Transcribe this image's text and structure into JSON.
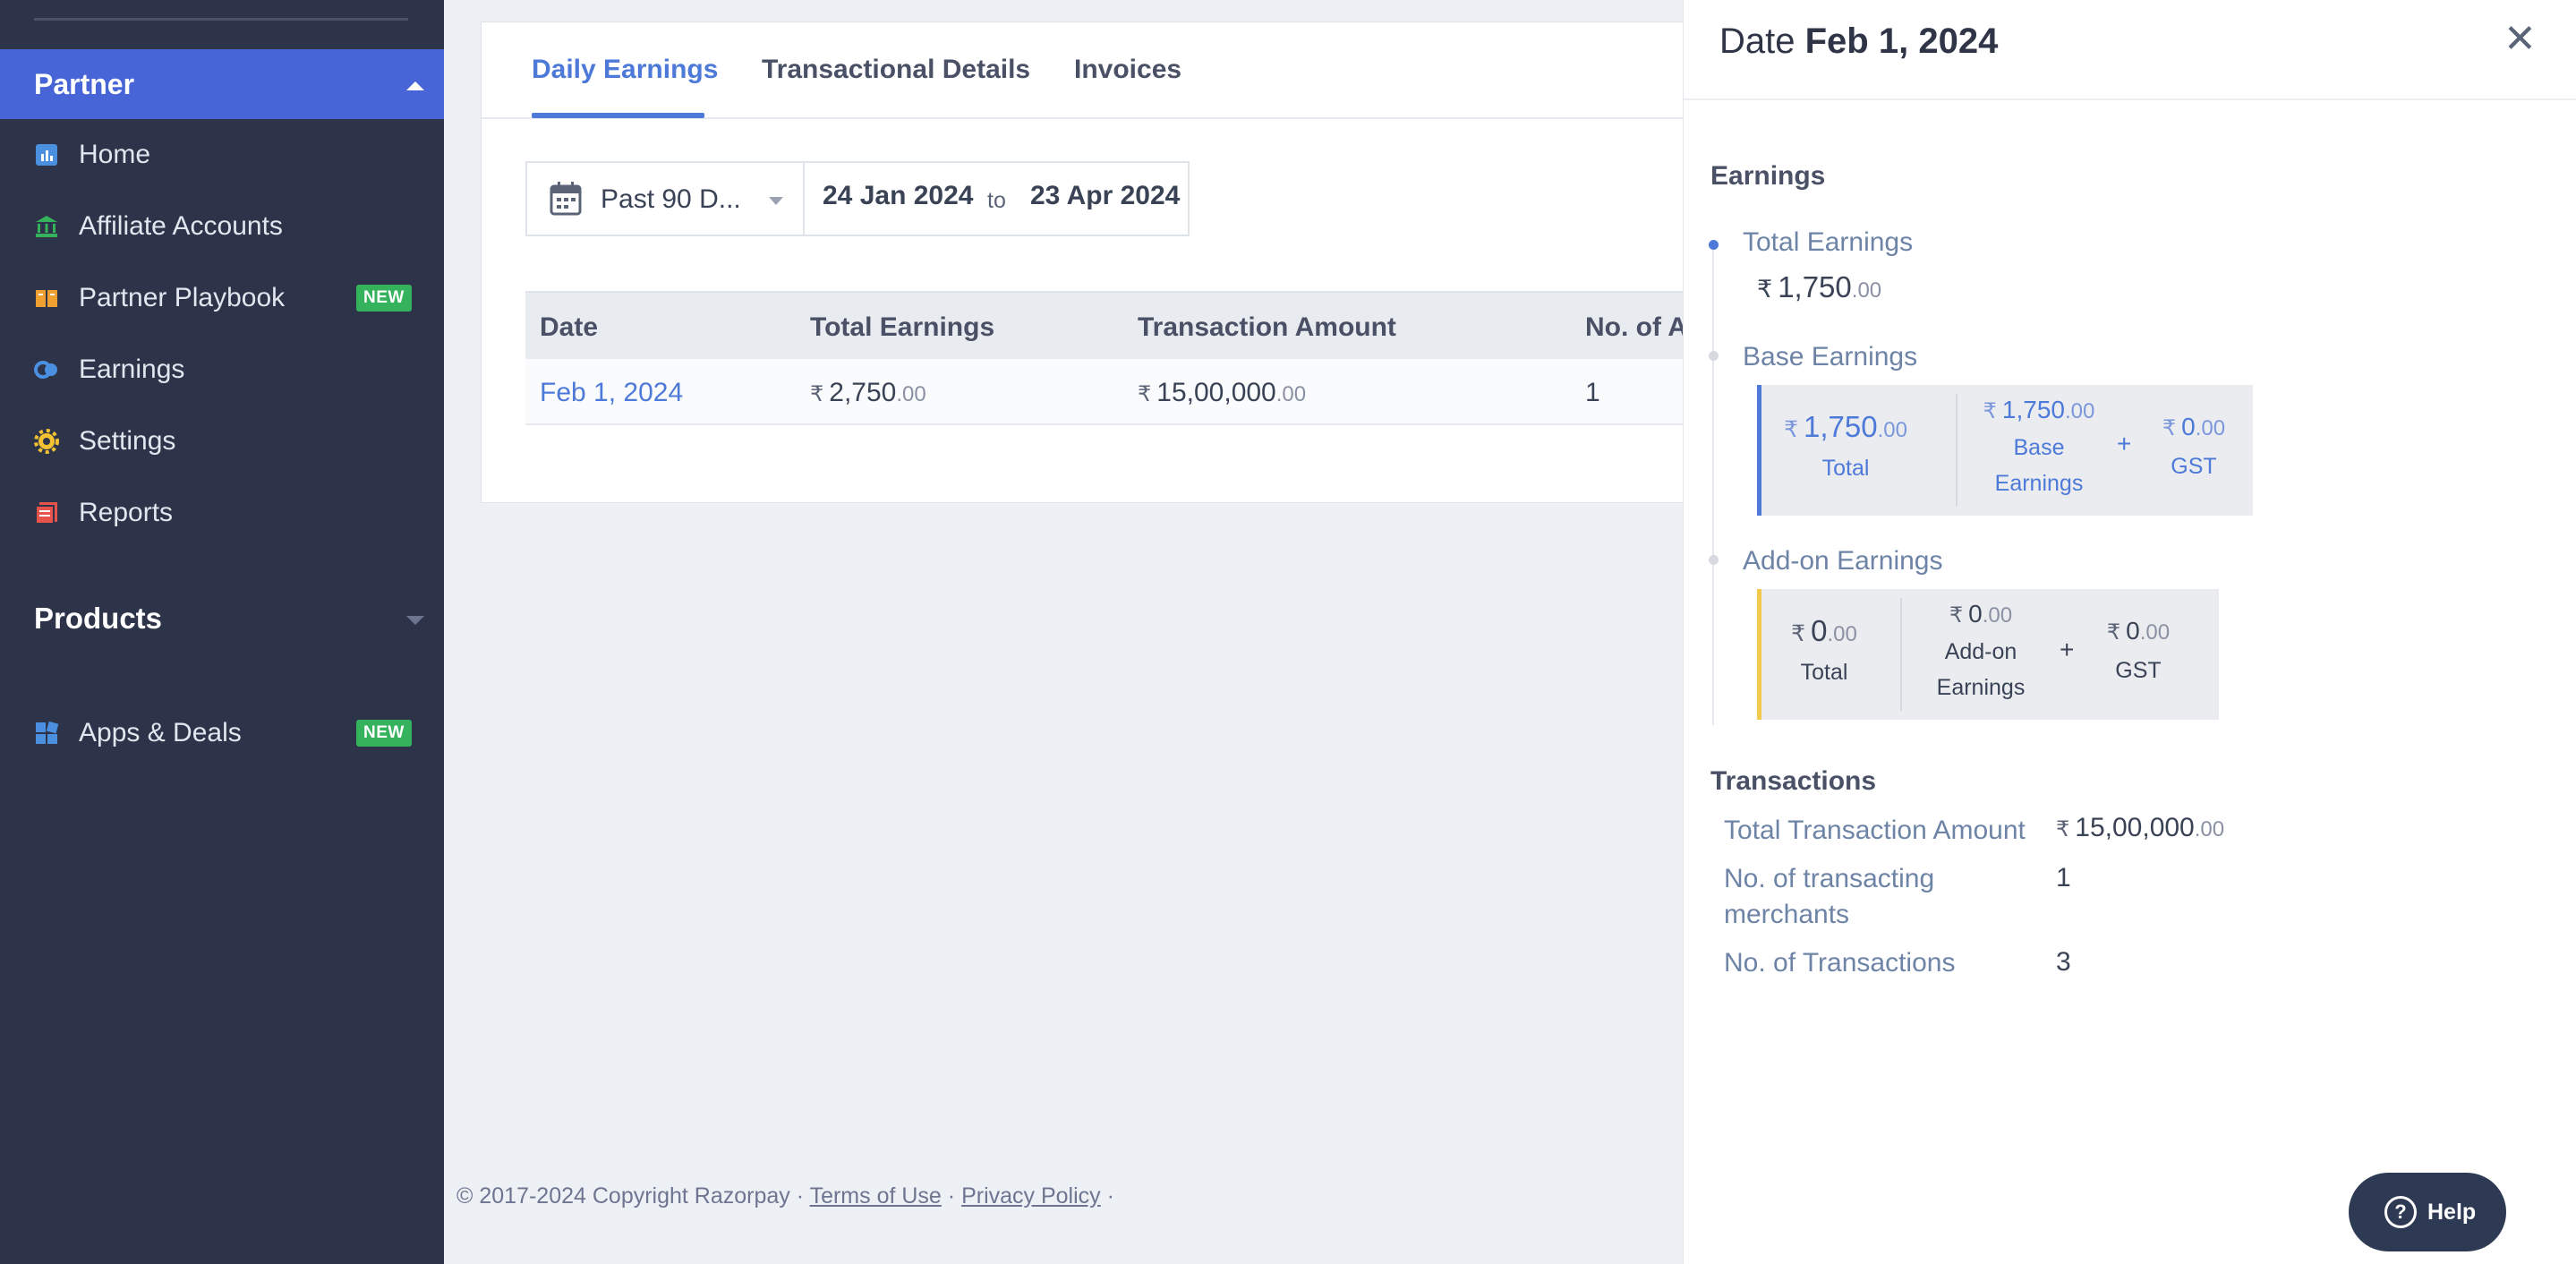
{
  "sidebar": {
    "section_title": "Partner",
    "items": [
      {
        "label": "Home",
        "icon": "chart-icon"
      },
      {
        "label": "Affiliate Accounts",
        "icon": "bank-icon"
      },
      {
        "label": "Partner Playbook",
        "icon": "book-icon",
        "badge": "NEW"
      },
      {
        "label": "Earnings",
        "icon": "earnings-icon"
      },
      {
        "label": "Settings",
        "icon": "gear-icon"
      },
      {
        "label": "Reports",
        "icon": "report-icon"
      }
    ],
    "products_label": "Products",
    "apps": {
      "label": "Apps & Deals",
      "badge": "NEW",
      "icon": "grid-icon"
    }
  },
  "tabs": [
    "Daily Earnings",
    "Transactional Details",
    "Invoices"
  ],
  "filter": {
    "preset": "Past 90 D...",
    "from": "24 Jan 2024",
    "to_label": "to",
    "to": "23 Apr 2024"
  },
  "table": {
    "headers": [
      "Date",
      "Total Earnings",
      "Transaction Amount",
      "No. of Ac"
    ],
    "rows": [
      {
        "date": "Feb 1, 2024",
        "earn_int": "2,750",
        "earn_dec": ".00",
        "amt_int": "15,00,000",
        "amt_dec": ".00",
        "count": "1"
      }
    ]
  },
  "currency": "₹",
  "footer": {
    "copyright": "© 2017-2024 Copyright Razorpay ·",
    "terms": "Terms of Use",
    "sep": "·",
    "privacy": "Privacy Policy",
    "end": "·"
  },
  "panel": {
    "title_prefix": "Date",
    "title_date": "Feb 1, 2024",
    "earnings_title": "Earnings",
    "total_label": "Total Earnings",
    "total_int": "1,750",
    "total_dec": ".00",
    "base": {
      "label": "Base Earnings",
      "total_int": "1,750",
      "total_dec": ".00",
      "total_label": "Total",
      "base_int": "1,750",
      "base_dec": ".00",
      "base_label_1": "Base",
      "base_label_2": "Earnings",
      "gst_int": "0",
      "gst_dec": ".00",
      "gst_label": "GST",
      "plus": "+"
    },
    "addon": {
      "label": "Add-on Earnings",
      "total_int": "0",
      "total_dec": ".00",
      "total_label": "Total",
      "addon_int": "0",
      "addon_dec": ".00",
      "addon_label_1": "Add-on",
      "addon_label_2": "Earnings",
      "gst_int": "0",
      "gst_dec": ".00",
      "gst_label": "GST",
      "plus": "+"
    },
    "transactions_title": "Transactions",
    "transactions": [
      {
        "label": "Total Transaction Amount",
        "int": "15,00,000",
        "dec": ".00"
      },
      {
        "label_1": "No. of transacting",
        "label_2": "merchants",
        "value": "1"
      },
      {
        "label": "No. of Transactions",
        "value": "3"
      }
    ]
  },
  "help_label": "Help",
  "colors": {
    "accent": "#4d79d8",
    "sidebar_bg": "#2d3348",
    "section_bg": "#4765d6",
    "addon_bar": "#f2c94c",
    "new_badge": "#35b25c"
  }
}
